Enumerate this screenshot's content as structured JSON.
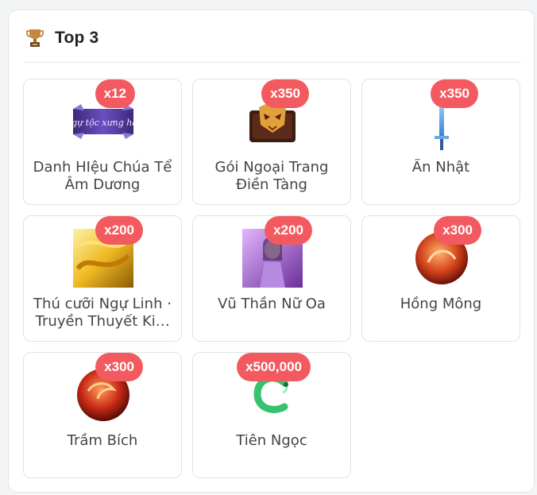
{
  "panel": {
    "title": "Top 3",
    "icon": "trophy-icon"
  },
  "items": [
    {
      "quantity": "x12",
      "name": "Danh HIệu Chúa Tể Âm Dương",
      "image": "title-banner-image",
      "image_caption": "Ngự tộc xưng hào"
    },
    {
      "quantity": "x350",
      "name": "Gói Ngoại Trang Điền Tàng",
      "image": "mask-chest-image"
    },
    {
      "quantity": "x350",
      "name": "Ẩn Nhật",
      "image": "sword-image"
    },
    {
      "quantity": "x200",
      "name": "Thú cưỡi Ngự Linh · Truyền Thuyết Kim Long",
      "image": "golden-dragon-image"
    },
    {
      "quantity": "x200",
      "name": "Vũ Thần Nữ Oa",
      "image": "goddess-portrait-image"
    },
    {
      "quantity": "x300",
      "name": "Hồng Mông",
      "image": "red-orb-image"
    },
    {
      "quantity": "x300",
      "name": "Trầm Bích",
      "image": "red-dragon-orb-image"
    },
    {
      "quantity": "x500,000",
      "name": "Tiên Ngọc",
      "image": "jade-dragon-image"
    }
  ],
  "colors": {
    "badge": "#f25a5f",
    "border": "#dfe2e6",
    "text": "#444444"
  }
}
